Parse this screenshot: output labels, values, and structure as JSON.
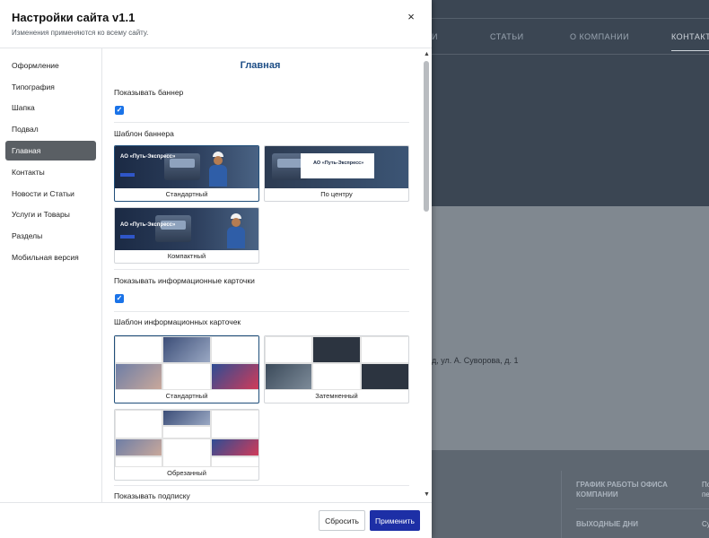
{
  "background_site": {
    "nav": [
      "И",
      "СТАТЬИ",
      "О КОМПАНИИ",
      "КОНТАКТЫ"
    ],
    "address": "д, ул. А. Суворова, д. 1",
    "footer": {
      "schedule_label_line1": "ГРАФИК РАБОТЫ ОФИСА",
      "schedule_label_line2": "КОМПАНИИ",
      "schedule_value_line1": "По",
      "schedule_value_line2": "пе",
      "weekend_label": "ВЫХОДНЫЕ ДНИ",
      "weekend_value": "Су"
    }
  },
  "panel": {
    "title": "Настройки сайта v1.1",
    "subtitle": "Изменения применяются ко всему сайту.",
    "close_glyph": "×"
  },
  "sidebar": {
    "items": [
      {
        "label": "Оформление",
        "active": false
      },
      {
        "label": "Типография",
        "active": false
      },
      {
        "label": "Шапка",
        "active": false
      },
      {
        "label": "Подвал",
        "active": false
      },
      {
        "label": "Главная",
        "active": true
      },
      {
        "label": "Контакты",
        "active": false
      },
      {
        "label": "Новости и Статьи",
        "active": false
      },
      {
        "label": "Услуги и Товары",
        "active": false
      },
      {
        "label": "Разделы",
        "active": false
      },
      {
        "label": "Мобильная версия",
        "active": false
      }
    ]
  },
  "content": {
    "section_title": "Главная",
    "show_banner": {
      "label": "Показывать баннер",
      "checked": true
    },
    "banner_template": {
      "label": "Шаблон баннера",
      "options": [
        {
          "caption": "Стандартный",
          "selected": true,
          "brand": "АО «Путь-Экспресс»"
        },
        {
          "caption": "По центру",
          "selected": false,
          "brand": "АО «Путь-Экспресс»"
        },
        {
          "caption": "Компактный",
          "selected": false,
          "brand": "АО «Путь-Экспресс»"
        }
      ]
    },
    "show_info_cards": {
      "label": "Показывать информационные карточки",
      "checked": true
    },
    "info_cards_template": {
      "label": "Шаблон информационных карточек",
      "options": [
        {
          "caption": "Стандартный",
          "selected": true
        },
        {
          "caption": "Затемненный",
          "selected": false
        },
        {
          "caption": "Обрезанный",
          "selected": false
        }
      ]
    },
    "show_subscription": {
      "label": "Показывать подписку"
    }
  },
  "scrollbar": {
    "up_glyph": "▲",
    "down_glyph": "▼"
  },
  "footer": {
    "reset_label": "Сбросить",
    "apply_label": "Применить"
  },
  "colors": {
    "accent": "#1d2fa6",
    "section_title": "#1d4e86",
    "active_nav": "#5a5f64",
    "checkbox": "#1a73e8"
  }
}
